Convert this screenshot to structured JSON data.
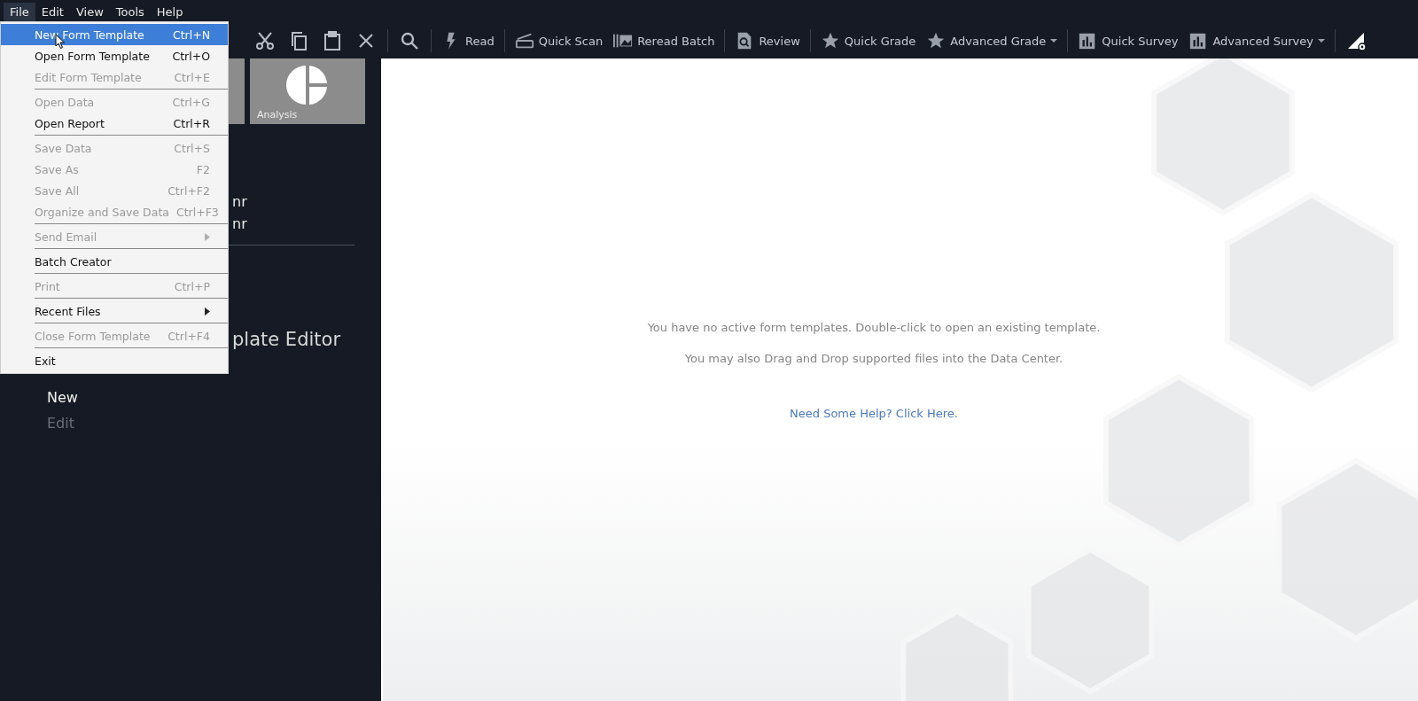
{
  "menubar": [
    {
      "label": "File",
      "selected": true
    },
    {
      "label": "Edit",
      "selected": false
    },
    {
      "label": "View",
      "selected": false
    },
    {
      "label": "Tools",
      "selected": false
    },
    {
      "label": "Help",
      "selected": false
    }
  ],
  "toolbar": [
    {
      "kind": "icon"
    },
    {
      "kind": "icon"
    },
    {
      "kind": "icon"
    },
    {
      "kind": "icon"
    },
    {
      "kind": "separator"
    },
    {
      "kind": "icon"
    },
    {
      "kind": "separator"
    },
    {
      "kind": "button",
      "label": "Read"
    },
    {
      "kind": "separator"
    },
    {
      "kind": "button",
      "label": "Quick Scan"
    },
    {
      "kind": "button",
      "label": "Reread Batch"
    },
    {
      "kind": "separator"
    },
    {
      "kind": "button",
      "label": "Review"
    },
    {
      "kind": "separator"
    },
    {
      "kind": "button",
      "label": "Quick Grade"
    },
    {
      "kind": "dropdown",
      "label": "Advanced Grade"
    },
    {
      "kind": "separator"
    },
    {
      "kind": "button",
      "label": "Quick Survey"
    },
    {
      "kind": "dropdown",
      "label": "Advanced Survey"
    },
    {
      "kind": "separator"
    },
    {
      "kind": "icon"
    }
  ],
  "tiles": [
    {
      "label": "Analysis"
    }
  ],
  "left_panel": {
    "fragments": [
      "nr",
      "nr"
    ],
    "heading_fragment": "plate Editor",
    "actions": [
      {
        "label": "New",
        "disabled": false
      },
      {
        "label": "Edit",
        "disabled": true
      }
    ]
  },
  "file_menu": [
    {
      "label": "New Form Template",
      "shortcut": "Ctrl+N",
      "disabled": false,
      "selected": true,
      "separator_after": false,
      "submenu": false
    },
    {
      "label": "Open Form Template",
      "shortcut": "Ctrl+O",
      "disabled": false,
      "selected": false,
      "separator_after": false,
      "submenu": false
    },
    {
      "label": "Edit Form Template",
      "shortcut": "Ctrl+E",
      "disabled": true,
      "selected": false,
      "separator_after": true,
      "submenu": false
    },
    {
      "label": "Open Data",
      "shortcut": "Ctrl+G",
      "disabled": true,
      "selected": false,
      "separator_after": false,
      "submenu": false
    },
    {
      "label": "Open Report",
      "shortcut": "Ctrl+R",
      "disabled": false,
      "selected": false,
      "separator_after": true,
      "submenu": false
    },
    {
      "label": "Save Data",
      "shortcut": "Ctrl+S",
      "disabled": true,
      "selected": false,
      "separator_after": false,
      "submenu": false
    },
    {
      "label": "Save As",
      "shortcut": "F2",
      "disabled": true,
      "selected": false,
      "separator_after": false,
      "submenu": false
    },
    {
      "label": "Save All",
      "shortcut": "Ctrl+F2",
      "disabled": true,
      "selected": false,
      "separator_after": false,
      "submenu": false
    },
    {
      "label": "Organize and Save Data",
      "shortcut": "Ctrl+F3",
      "disabled": true,
      "selected": false,
      "separator_after": true,
      "submenu": false
    },
    {
      "label": "Send Email",
      "submenu": true,
      "disabled": true,
      "selected": false,
      "separator_after": true
    },
    {
      "label": "Batch Creator",
      "disabled": false,
      "selected": false,
      "separator_after": true,
      "submenu": false
    },
    {
      "label": "Print",
      "shortcut": "Ctrl+P",
      "disabled": true,
      "selected": false,
      "separator_after": true,
      "submenu": false
    },
    {
      "label": "Recent Files",
      "submenu": true,
      "disabled": false,
      "selected": false,
      "separator_after": true
    },
    {
      "label": "Close Form Template",
      "shortcut": "Ctrl+F4",
      "disabled": true,
      "selected": false,
      "separator_after": true,
      "submenu": false
    },
    {
      "label": "Exit",
      "disabled": false,
      "selected": false,
      "separator_after": false,
      "submenu": false
    }
  ],
  "data_center": {
    "messages": [
      "You have no active form templates. Double-click to open an existing template.",
      "You may also Drag and Drop supported files into the Data Center."
    ],
    "help_link": "Need Some Help? Click Here."
  }
}
